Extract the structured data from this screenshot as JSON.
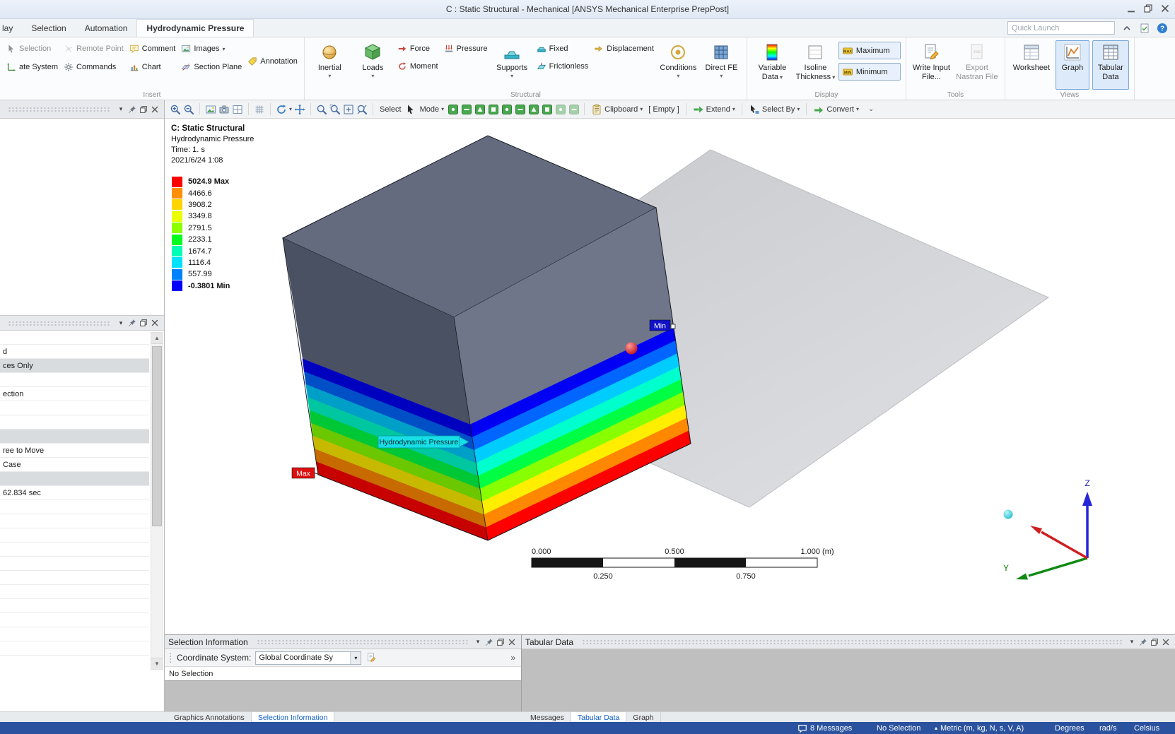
{
  "titlebar": {
    "title": "C : Static Structural - Mechanical [ANSYS Mechanical Enterprise PrepPost]"
  },
  "menubar": {
    "tabs": [
      "lay",
      "Selection",
      "Automation",
      "Hydrodynamic Pressure"
    ],
    "quick_launch_placeholder": "Quick Launch"
  },
  "ribbon": {
    "insert": {
      "label": "Insert",
      "selection": "Selection",
      "remote_point": "Remote Point",
      "comment": "Comment",
      "images": "Images",
      "coordinate_system": "ate System",
      "commands": "Commands",
      "chart": "Chart",
      "section_plane": "Section Plane",
      "annotation": "Annotation"
    },
    "structural": {
      "label": "Structural",
      "inertial": "Inertial",
      "loads": "Loads",
      "force": "Force",
      "pressure": "Pressure",
      "moment": "Moment",
      "supports": "Supports",
      "fixed": "Fixed",
      "frictionless": "Frictionless",
      "displacement": "Displacement",
      "conditions": "Conditions",
      "direct_fe": "Direct FE"
    },
    "display": {
      "label": "Display",
      "variable_data_line1": "Variable",
      "variable_data_line2": "Data",
      "isoline_line1": "Isoline",
      "isoline_line2": "Thickness",
      "maximum": "Maximum",
      "minimum": "Minimum"
    },
    "tools": {
      "label": "Tools",
      "write_input_line1": "Write Input",
      "write_input_line2": "File...",
      "export_line1": "Export",
      "export_line2": "Nastran File"
    },
    "views": {
      "label": "Views",
      "worksheet": "Worksheet",
      "graph": "Graph",
      "tabular_line1": "Tabular",
      "tabular_line2": "Data"
    }
  },
  "toolbar": {
    "left_icons": [
      "zoom-in",
      "zoom-out",
      "sep",
      "figure",
      "image-capture",
      "viewport-layout",
      "sep",
      "snap-grid",
      "sep",
      "rotate",
      "caret",
      "pan",
      "sep",
      "zoom",
      "zoom-box",
      "zoom-fit",
      "zoom-all",
      "sep"
    ],
    "select_label": "Select",
    "mode_label": "Mode",
    "filter_icons": [
      "select-vertex",
      "select-edge",
      "select-face",
      "select-body",
      "select-node",
      "select-element",
      "select-box",
      "select-lasso",
      "select-named",
      "select-path"
    ],
    "clipboard_label": "Clipboard",
    "empty_label": "[ Empty ]",
    "extend_label": "Extend",
    "select_by_label": "Select By",
    "convert_label": "Convert"
  },
  "viewport": {
    "header_line1": "C: Static Structural",
    "header_line2": "Hydrodynamic Pressure",
    "header_line3": "Time: 1. s",
    "header_line4": "2021/6/24 1:08"
  },
  "legend": {
    "entries": [
      {
        "color": "#ff0000",
        "label": "5024.9 Max"
      },
      {
        "color": "#ff8f00",
        "label": "4466.6"
      },
      {
        "color": "#ffd500",
        "label": "3908.2"
      },
      {
        "color": "#eaff00",
        "label": "3349.8"
      },
      {
        "color": "#8cff00",
        "label": "2791.5"
      },
      {
        "color": "#00ff1e",
        "label": "2233.1"
      },
      {
        "color": "#00ffb4",
        "label": "1674.7"
      },
      {
        "color": "#00e1ff",
        "label": "1116.4"
      },
      {
        "color": "#0082ff",
        "label": "557.99"
      },
      {
        "color": "#0000ff",
        "label": "-0.3801 Min"
      }
    ]
  },
  "scene": {
    "min_label": "Min",
    "max_label": "Max",
    "pressure_tag": "Hydrodynamic Pressure",
    "band_colors": [
      "#0000f5",
      "#0066ff",
      "#00ccff",
      "#00ffcc",
      "#00ff44",
      "#88ff00",
      "#ffee00",
      "#ff8800",
      "#ff0000"
    ]
  },
  "scale_bar": {
    "top_labels": [
      "0.000",
      "0.500",
      "1.000 (m)"
    ],
    "bottom_labels": [
      "0.250",
      "0.750"
    ]
  },
  "triad": {
    "z": "Z",
    "y": "Y"
  },
  "details_panel": {
    "rows": [
      {
        "text": "",
        "gray": false
      },
      {
        "text": "d",
        "gray": false
      },
      {
        "text": "ces Only",
        "gray": true
      },
      {
        "text": "",
        "gray": false
      },
      {
        "text": "ection",
        "gray": false
      },
      {
        "text": "",
        "gray": false
      },
      {
        "text": "",
        "gray": false
      },
      {
        "text": "",
        "gray": true
      },
      {
        "text": "ree to Move",
        "gray": false
      },
      {
        "text": "Case",
        "gray": false
      },
      {
        "text": "",
        "gray": true
      },
      {
        "text": "62.834 sec",
        "gray": false
      },
      {
        "text": "",
        "gray": false
      },
      {
        "text": "",
        "gray": false
      },
      {
        "text": "",
        "gray": false
      },
      {
        "text": "",
        "gray": false
      },
      {
        "text": "",
        "gray": false
      },
      {
        "text": "",
        "gray": false
      },
      {
        "text": "",
        "gray": false
      },
      {
        "text": "",
        "gray": false
      },
      {
        "text": "",
        "gray": false
      },
      {
        "text": "",
        "gray": false
      },
      {
        "text": "",
        "gray": false
      }
    ]
  },
  "selection_info": {
    "title": "Selection Information",
    "coordinate_system_label": "Coordinate System:",
    "coordinate_system_value": "Global Coordinate Sy",
    "status": "No Selection"
  },
  "tabular_data": {
    "title": "Tabular Data"
  },
  "bottom_tabs": {
    "left": [
      "Graphics Annotations",
      "Selection Information"
    ],
    "right": [
      "Messages",
      "Tabular Data",
      "Graph"
    ]
  },
  "statusbar": {
    "messages": "8 Messages",
    "selection": "No Selection",
    "units": "Metric (m, kg, N, s, V, A)",
    "angle": "Degrees",
    "angular_velocity": "rad/s",
    "temperature": "Celsius"
  }
}
